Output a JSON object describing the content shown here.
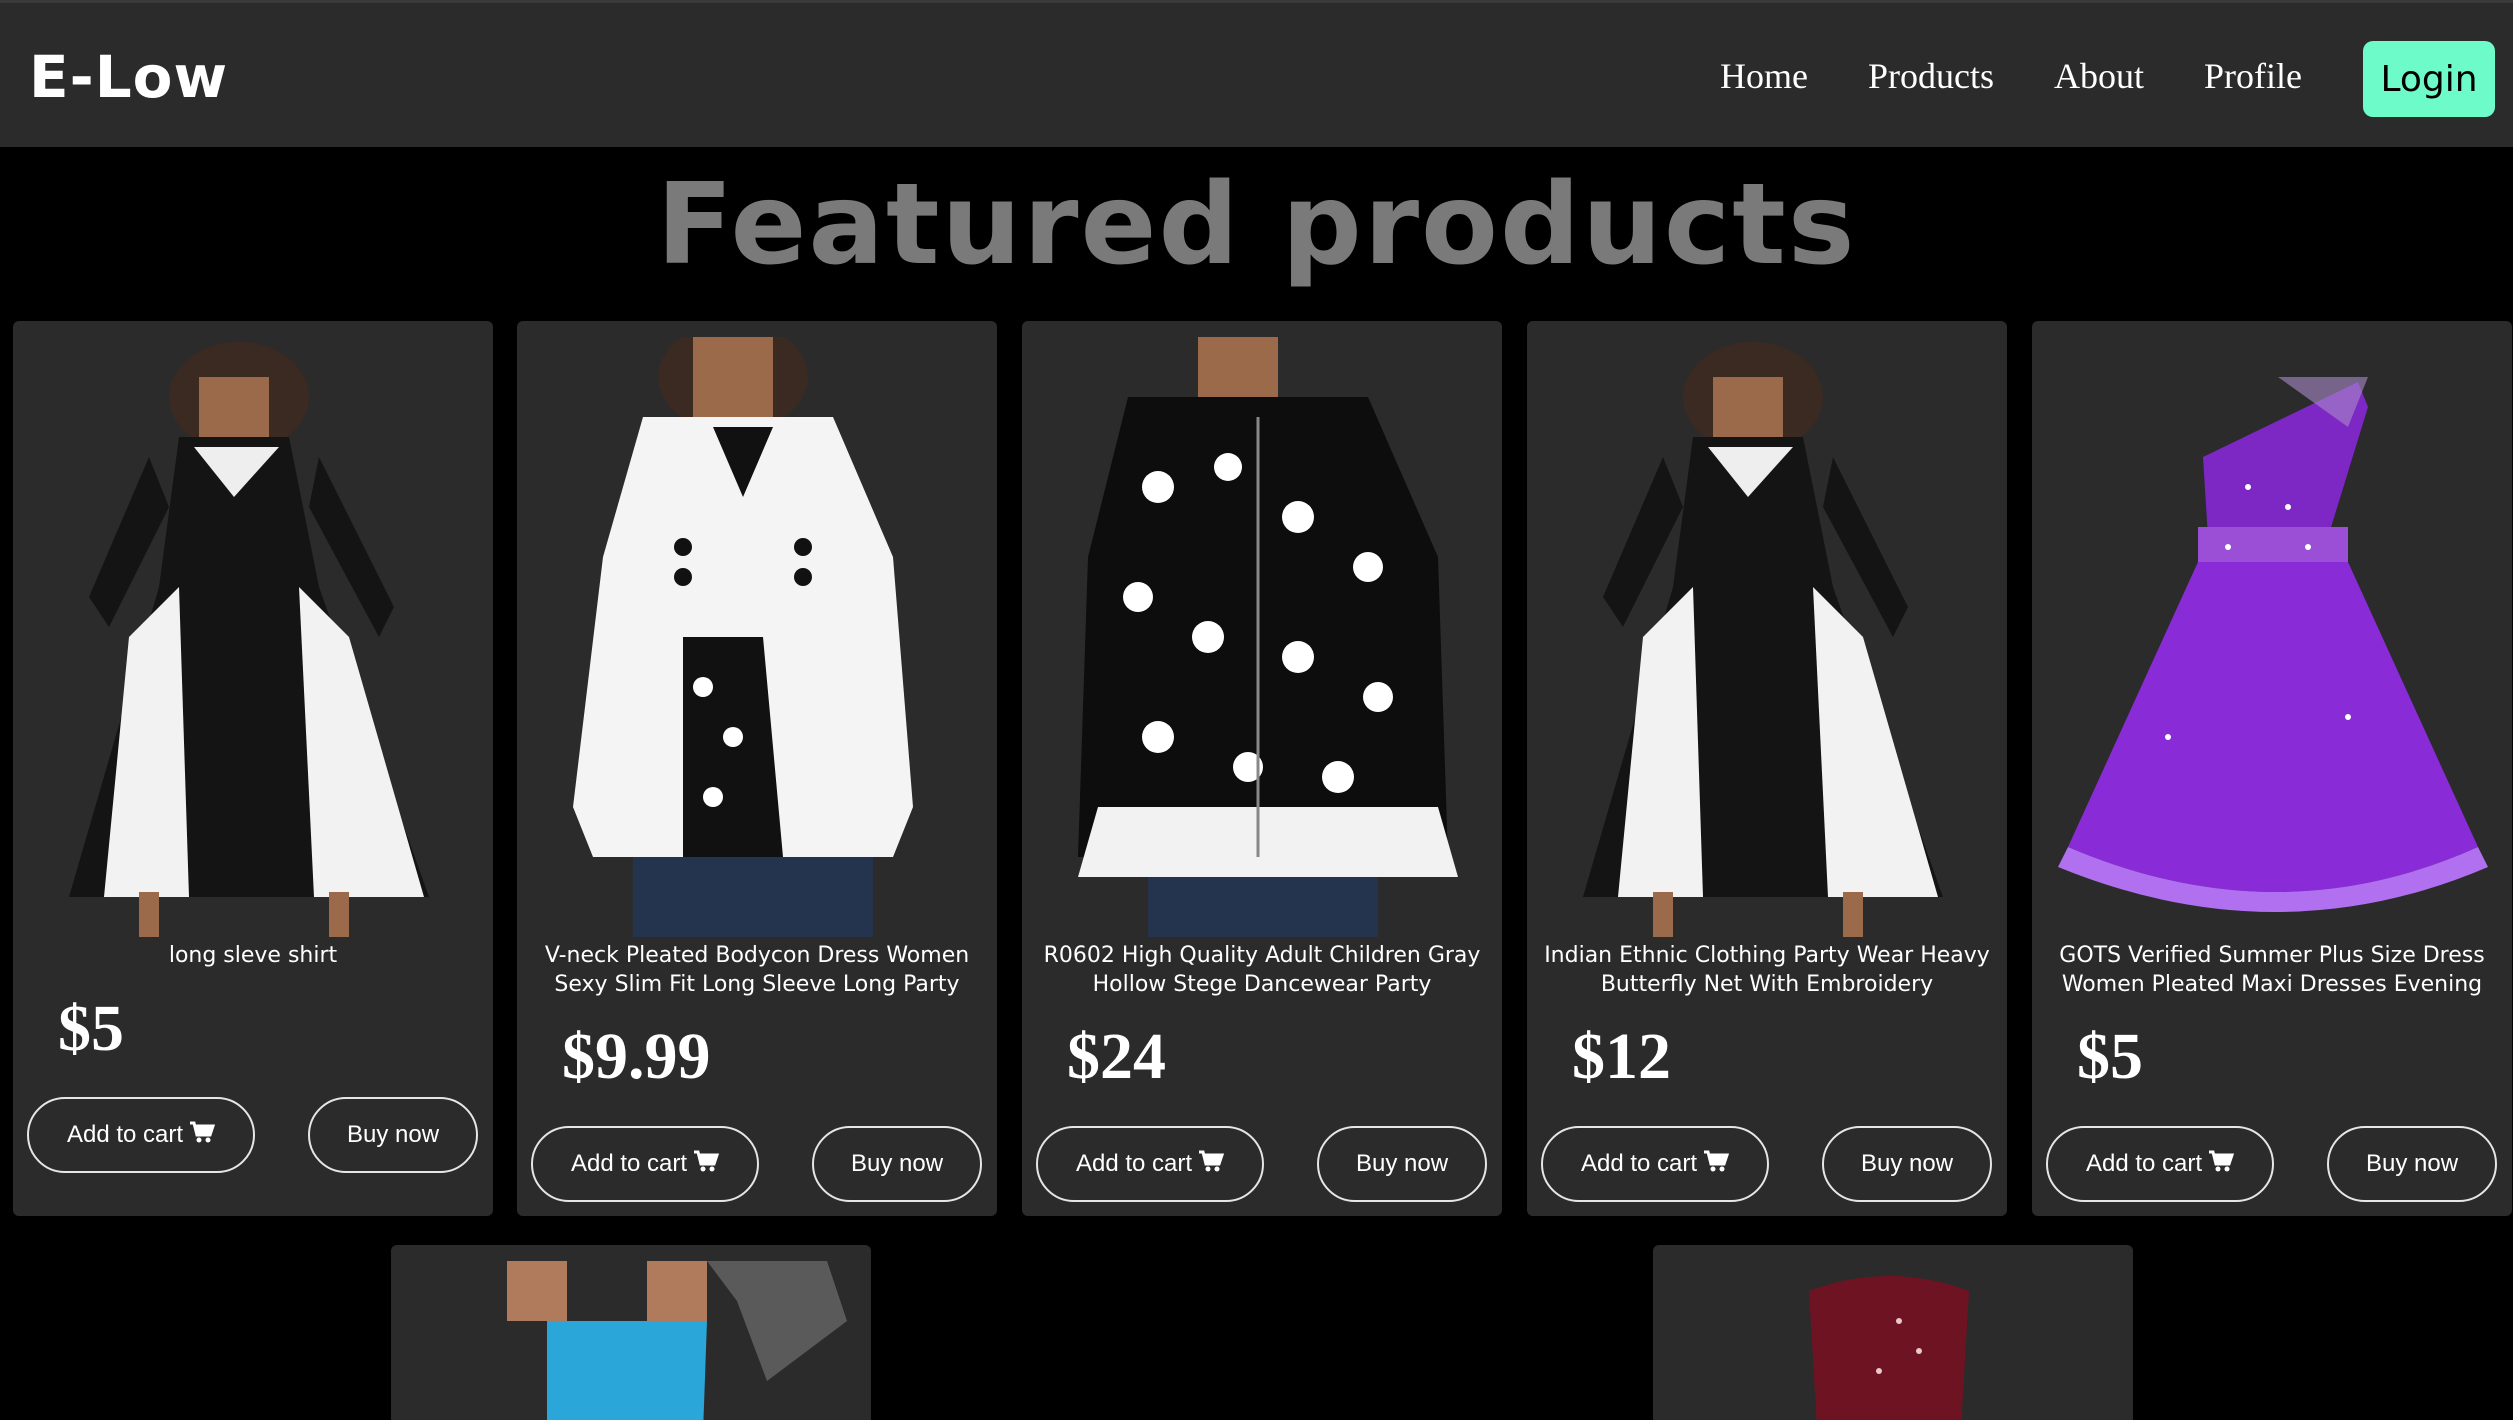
{
  "navbar": {
    "brand": "E-Low",
    "links": [
      "Home",
      "Products",
      "About",
      "Profile"
    ],
    "login_label": "Login",
    "accent_color": "#6dfcc9"
  },
  "heading": "Featured products",
  "products": [
    {
      "title": "long sleve shirt",
      "price": "$5",
      "add_label": "Add to cart",
      "buy_label": "Buy now"
    },
    {
      "title": "V-neck Pleated Bodycon Dress Women Sexy Slim Fit Long Sleeve Long Party",
      "price": "$9.99",
      "add_label": "Add to cart",
      "buy_label": "Buy now"
    },
    {
      "title": "R0602 High Quality Adult Children Gray Hollow Stege Dancewear Party",
      "price": "$24",
      "add_label": "Add to cart",
      "buy_label": "Buy now"
    },
    {
      "title": "Indian Ethnic Clothing Party Wear Heavy Butterfly Net With Embroidery",
      "price": "$12",
      "add_label": "Add to cart",
      "buy_label": "Buy now"
    },
    {
      "title": "GOTS Verified Summer Plus Size Dress Women Pleated Maxi Dresses Evening",
      "price": "$5",
      "add_label": "Add to cart",
      "buy_label": "Buy now"
    }
  ],
  "icons": {
    "cart": "shopping-cart-icon"
  }
}
